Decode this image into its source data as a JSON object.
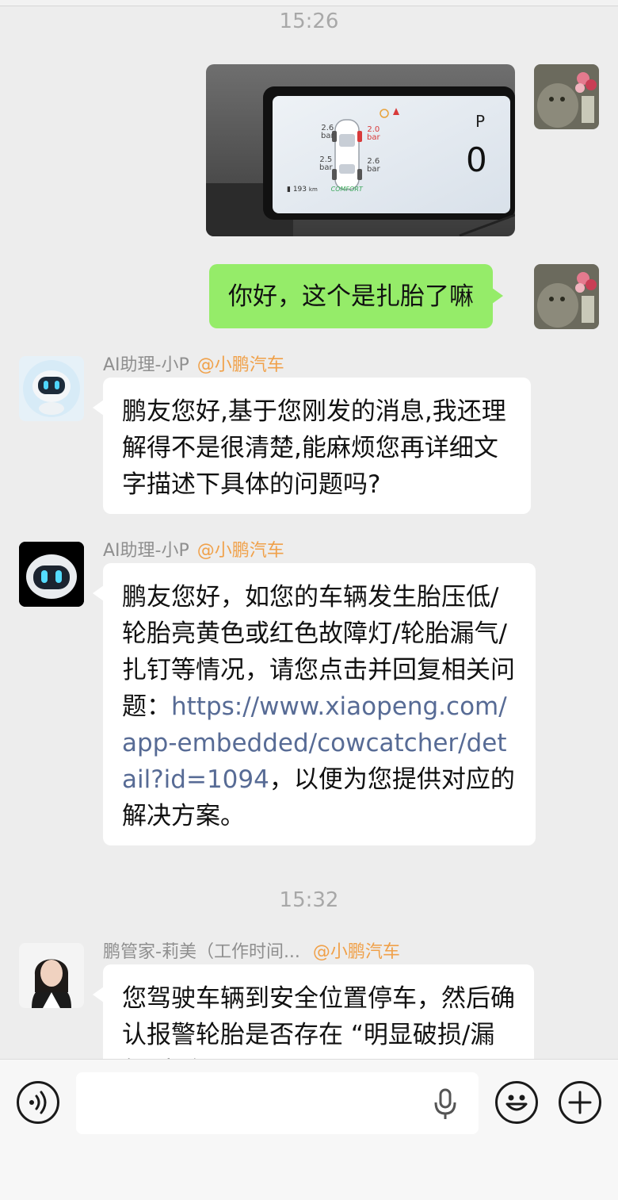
{
  "timestamps": [
    "15:26",
    "15:32"
  ],
  "outgoing": {
    "photo": {
      "tire_pressures": {
        "front_left": "2.6",
        "front_right": "2.0",
        "rear_left": "2.5",
        "rear_right": "2.6"
      },
      "unit": "bar",
      "gear": "P",
      "speed": "0",
      "range": "193",
      "range_unit": "km",
      "drive_mode": "COMFORT"
    },
    "text_message": "你好，这个是扎胎了嘛"
  },
  "messages": [
    {
      "sender": "AI助理-小P",
      "org": "@小鹏汽车",
      "text": "鹏友您好,基于您刚发的消息,我还理解得不是很清楚,能麻烦您再详细文字描述下具体的问题吗?"
    },
    {
      "sender": "AI助理-小P",
      "org": "@小鹏汽车",
      "text_before": "鹏友您好，如您的车辆发生胎压低/轮胎亮黄色或红色故障灯/轮胎漏气/扎钉等情况，请您点击并回复相关问题：",
      "link": "https://www.xiaopeng.com/app-embedded/cowcatcher/detail?id=1094",
      "text_after": "，以便为您提供对应的解决方案。"
    },
    {
      "sender": "鹏管家-莉美（工作时间...",
      "org": "@小鹏汽车",
      "text": "您驾驶车辆到安全位置停车，然后确认报警轮胎是否存在 “明显破损/漏气/瘪胎”"
    }
  ],
  "input": {
    "placeholder": ""
  },
  "colors": {
    "outgoing_bubble": "#95ec69",
    "link": "#576b95",
    "org_tag": "#f0a14a",
    "background": "#ededed"
  }
}
